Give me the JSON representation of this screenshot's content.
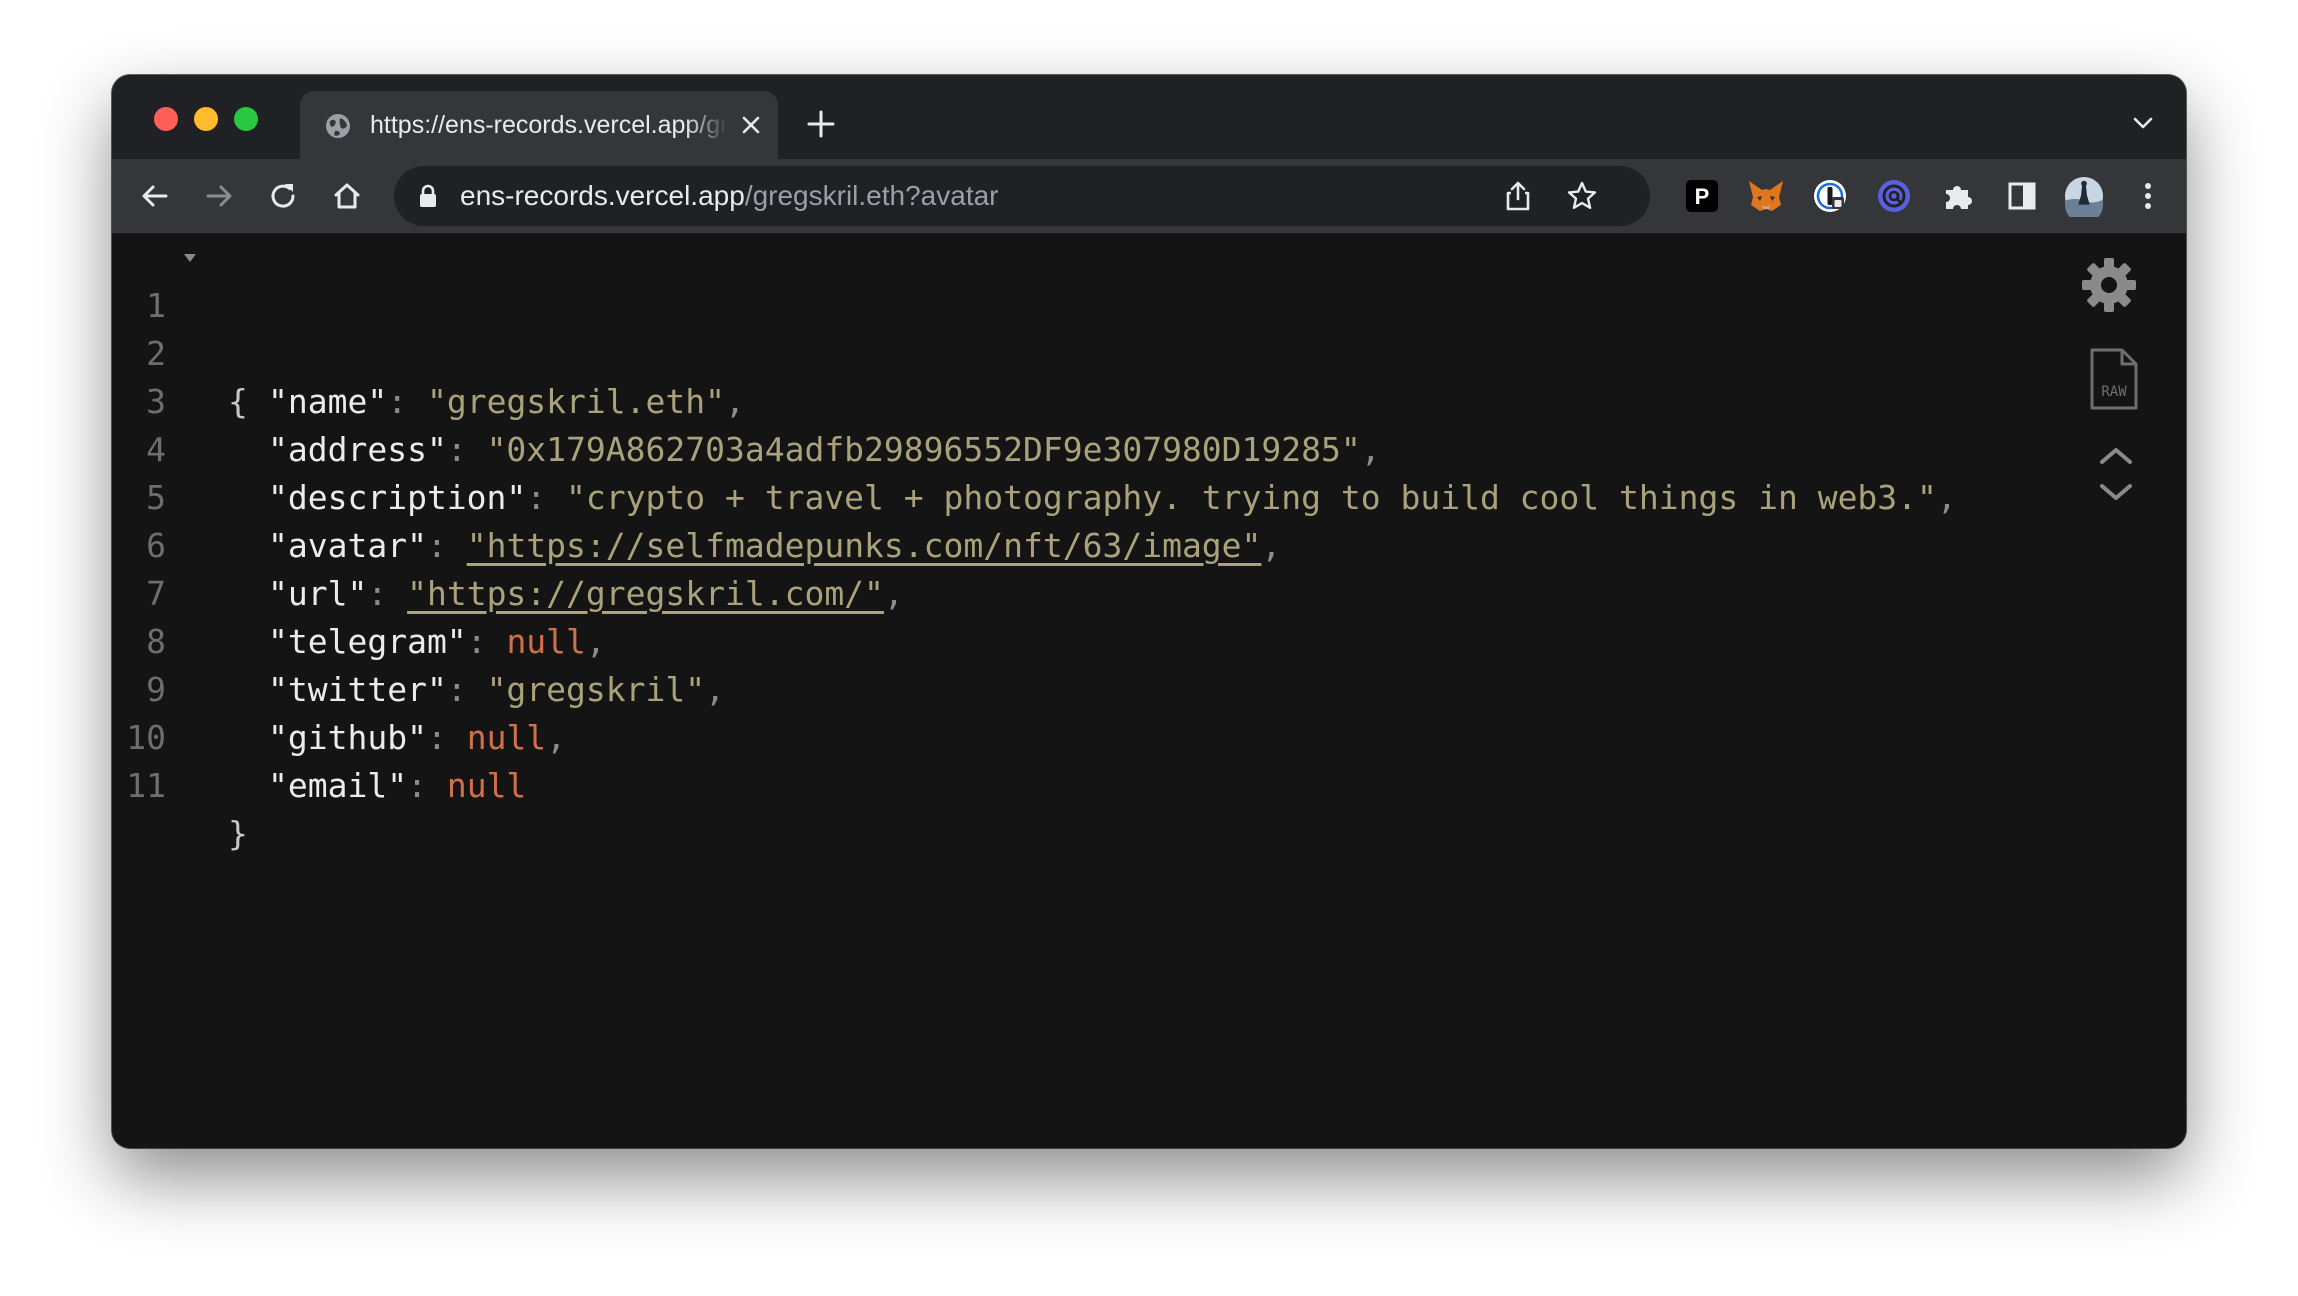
{
  "tab": {
    "title": "https://ens-records.vercel.app/gregskril.eth?avatar",
    "favicon": "globe-icon"
  },
  "address_bar": {
    "host": "ens-records.vercel.app",
    "path": "/gregskril.eth?avatar"
  },
  "extensions": [
    "pocket-icon",
    "metamask-icon",
    "1password-icon",
    "at-sign-icon",
    "puzzle-icon",
    "sidebar-icon",
    "profile-avatar",
    "kebab-menu-icon"
  ],
  "json": {
    "open_brace": "{",
    "close_brace": "}",
    "line_numbers": [
      "1",
      "2",
      "3",
      "4",
      "5",
      "6",
      "7",
      "8",
      "9",
      "10",
      "11"
    ],
    "entries": [
      {
        "key": "\"name\"",
        "value": "\"gregskril.eth\"",
        "kind": "string",
        "comma": ","
      },
      {
        "key": "\"address\"",
        "value": "\"0x179A862703a4adfb29896552DF9e307980D19285\"",
        "kind": "string",
        "comma": ","
      },
      {
        "key": "\"description\"",
        "value": "\"crypto + travel + photography. trying to build cool things in web3.\"",
        "kind": "string",
        "comma": ","
      },
      {
        "key": "\"avatar\"",
        "value": "\"https://selfmadepunks.com/nft/63/image\"",
        "kind": "link",
        "comma": ","
      },
      {
        "key": "\"url\"",
        "value": "\"https://gregskril.com/\"",
        "kind": "link",
        "comma": ","
      },
      {
        "key": "\"telegram\"",
        "value": "null",
        "kind": "null",
        "comma": ","
      },
      {
        "key": "\"twitter\"",
        "value": "\"gregskril\"",
        "kind": "string",
        "comma": ","
      },
      {
        "key": "\"github\"",
        "value": "null",
        "kind": "null",
        "comma": ","
      },
      {
        "key": "\"email\"",
        "value": "null",
        "kind": "null",
        "comma": ""
      }
    ],
    "colon": ": "
  },
  "viewer_tools": {
    "raw_label": "RAW"
  },
  "colors": {
    "key": "#ececec",
    "string": "#a9a27a",
    "null": "#d0704a",
    "line_number": "#6e6e6e",
    "background": "#141414"
  }
}
